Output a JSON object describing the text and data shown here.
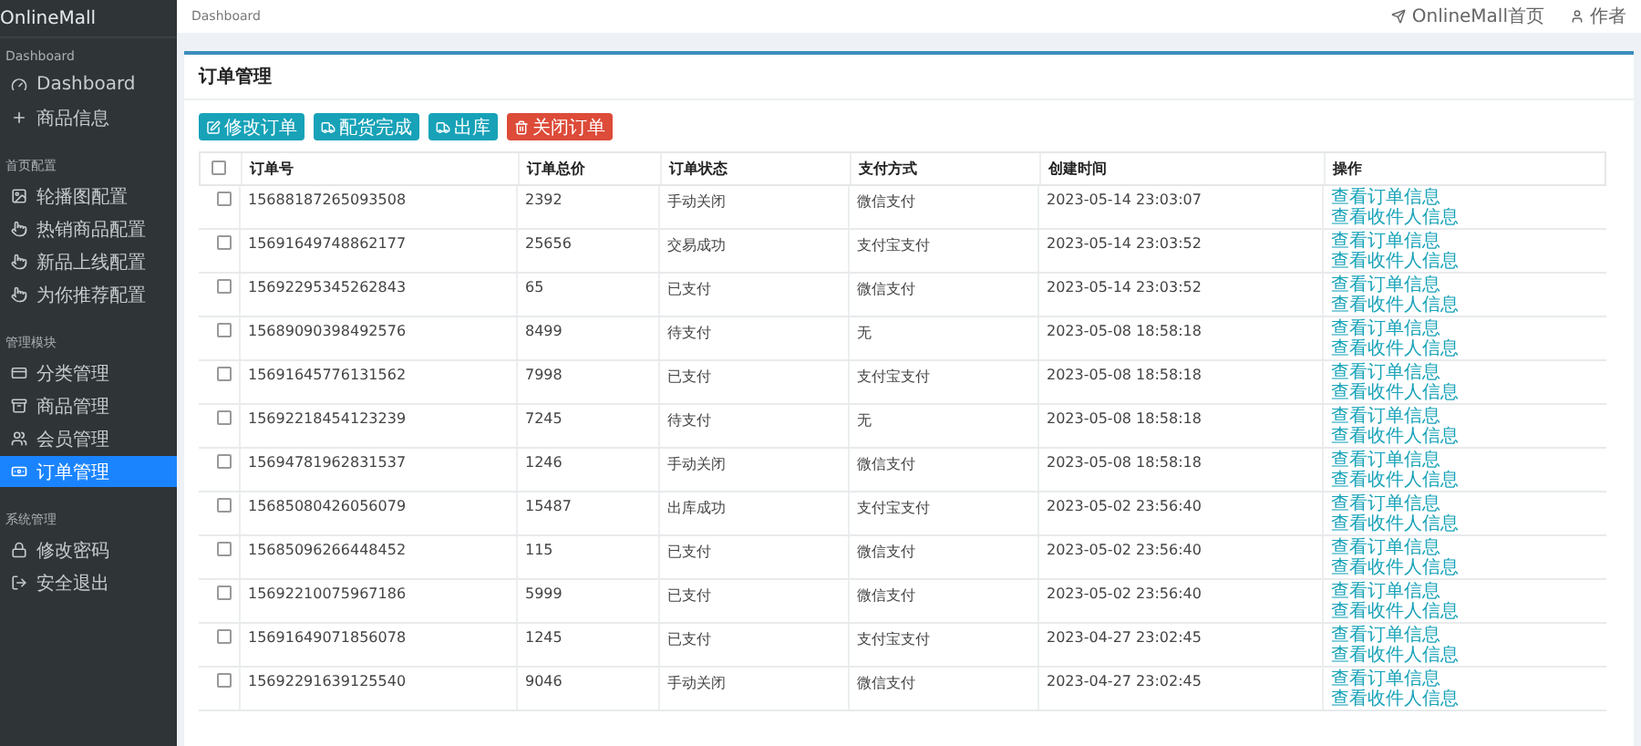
{
  "brand": "OnlineMall",
  "sidebar": {
    "sections": [
      {
        "title": "Dashboard",
        "items": [
          {
            "label": "Dashboard",
            "selected": false
          },
          {
            "label": "商品信息",
            "selected": false
          }
        ]
      },
      {
        "title": "首页配置",
        "items": [
          {
            "label": "轮播图配置",
            "selected": false
          },
          {
            "label": "热销商品配置",
            "selected": false
          },
          {
            "label": "新品上线配置",
            "selected": false
          },
          {
            "label": "为你推荐配置",
            "selected": false
          }
        ]
      },
      {
        "title": "管理模块",
        "items": [
          {
            "label": "分类管理",
            "selected": false
          },
          {
            "label": "商品管理",
            "selected": false
          },
          {
            "label": "会员管理",
            "selected": false
          },
          {
            "label": "订单管理",
            "selected": true
          }
        ]
      },
      {
        "title": "系统管理",
        "items": [
          {
            "label": "修改密码",
            "selected": false
          },
          {
            "label": "安全退出",
            "selected": false
          }
        ]
      }
    ]
  },
  "topbar": {
    "breadcrumb": "Dashboard",
    "links": [
      "OnlineMall首页",
      "作者"
    ]
  },
  "panel": {
    "title": "订单管理",
    "buttons": [
      {
        "label": "修改订单",
        "kind": "primary"
      },
      {
        "label": "配货完成",
        "kind": "primary"
      },
      {
        "label": "出库",
        "kind": "primary"
      },
      {
        "label": "关闭订单",
        "kind": "danger"
      }
    ],
    "table": {
      "select_all_checked": false,
      "columns": [
        "订单号",
        "订单总价",
        "订单状态",
        "支付方式",
        "创建时间",
        "操作"
      ],
      "rows": [
        {
          "checked": false,
          "cells": [
            "15688187265093508",
            "2392",
            "手动关闭",
            "微信支付",
            "2023-05-14 23:03:07"
          ],
          "actions": [
            "查看订单信息",
            "查看收件人信息"
          ]
        },
        {
          "checked": false,
          "cells": [
            "15691649748862177",
            "25656",
            "交易成功",
            "支付宝支付",
            "2023-05-14 23:03:52"
          ],
          "actions": [
            "查看订单信息",
            "查看收件人信息"
          ]
        },
        {
          "checked": false,
          "cells": [
            "15692295345262843",
            "65",
            "已支付",
            "微信支付",
            "2023-05-14 23:03:52"
          ],
          "actions": [
            "查看订单信息",
            "查看收件人信息"
          ]
        },
        {
          "checked": false,
          "cells": [
            "15689090398492576",
            "8499",
            "待支付",
            "无",
            "2023-05-08 18:58:18"
          ],
          "actions": [
            "查看订单信息",
            "查看收件人信息"
          ]
        },
        {
          "checked": false,
          "cells": [
            "15691645776131562",
            "7998",
            "已支付",
            "支付宝支付",
            "2023-05-08 18:58:18"
          ],
          "actions": [
            "查看订单信息",
            "查看收件人信息"
          ]
        },
        {
          "checked": false,
          "cells": [
            "15692218454123239",
            "7245",
            "待支付",
            "无",
            "2023-05-08 18:58:18"
          ],
          "actions": [
            "查看订单信息",
            "查看收件人信息"
          ]
        },
        {
          "checked": false,
          "cells": [
            "15694781962831537",
            "1246",
            "手动关闭",
            "微信支付",
            "2023-05-08 18:58:18"
          ],
          "actions": [
            "查看订单信息",
            "查看收件人信息"
          ]
        },
        {
          "checked": false,
          "cells": [
            "15685080426056079",
            "15487",
            "出库成功",
            "支付宝支付",
            "2023-05-02 23:56:40"
          ],
          "actions": [
            "查看订单信息",
            "查看收件人信息"
          ]
        },
        {
          "checked": false,
          "cells": [
            "15685096266448452",
            "115",
            "已支付",
            "微信支付",
            "2023-05-02 23:56:40"
          ],
          "actions": [
            "查看订单信息",
            "查看收件人信息"
          ]
        },
        {
          "checked": false,
          "cells": [
            "15692210075967186",
            "5999",
            "已支付",
            "微信支付",
            "2023-05-02 23:56:40"
          ],
          "actions": [
            "查看订单信息",
            "查看收件人信息"
          ]
        },
        {
          "checked": false,
          "cells": [
            "15691649071856078",
            "1245",
            "已支付",
            "支付宝支付",
            "2023-04-27 23:02:45"
          ],
          "actions": [
            "查看订单信息",
            "查看收件人信息"
          ]
        },
        {
          "checked": false,
          "cells": [
            "15692291639125540",
            "9046",
            "手动关闭",
            "微信支付",
            "2023-04-27 23:02:45"
          ],
          "actions": [
            "查看订单信息",
            "查看收件人信息"
          ]
        }
      ]
    }
  }
}
